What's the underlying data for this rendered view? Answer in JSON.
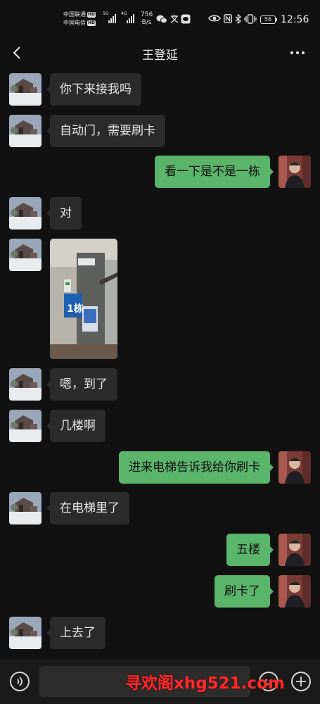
{
  "status_bar": {
    "carrier1": "中国联通",
    "carrier2": "中国电信",
    "hd": "HD",
    "net1": "5G",
    "net2": "4G",
    "speed_value": "756",
    "speed_unit": "B/s",
    "battery": "56",
    "time": "12:56"
  },
  "header": {
    "title": "王登延"
  },
  "messages": [
    {
      "side": "in",
      "type": "text",
      "text": "你下来接我吗"
    },
    {
      "side": "in",
      "type": "text",
      "text": "自动门，需要刷卡"
    },
    {
      "side": "out",
      "type": "text",
      "text": "看一下是不是一栋"
    },
    {
      "side": "in",
      "type": "text",
      "text": "对"
    },
    {
      "side": "in",
      "type": "image",
      "image_text": "1栋"
    },
    {
      "side": "in",
      "type": "text",
      "text": "嗯，到了"
    },
    {
      "side": "in",
      "type": "text",
      "text": "几楼啊"
    },
    {
      "side": "out",
      "type": "text",
      "text": "进来电梯告诉我给你刷卡"
    },
    {
      "side": "in",
      "type": "text",
      "text": "在电梯里了"
    },
    {
      "side": "out",
      "type": "text",
      "text": "五楼"
    },
    {
      "side": "out",
      "type": "text",
      "text": "刷卡了"
    },
    {
      "side": "in",
      "type": "text",
      "text": "上去了"
    }
  ],
  "input_bar": {
    "watermark": "寻欢阁xhg521.com"
  },
  "icons": {
    "back": "chevron-left-icon",
    "more": "more-dots-icon",
    "voice": "voice-icon",
    "emoji": "emoji-icon",
    "plus": "plus-icon"
  },
  "colors": {
    "background": "#111111",
    "incoming_bubble": "#2b2b2b",
    "outgoing_bubble": "#5ab46a",
    "watermark": "#ff2a2a"
  }
}
